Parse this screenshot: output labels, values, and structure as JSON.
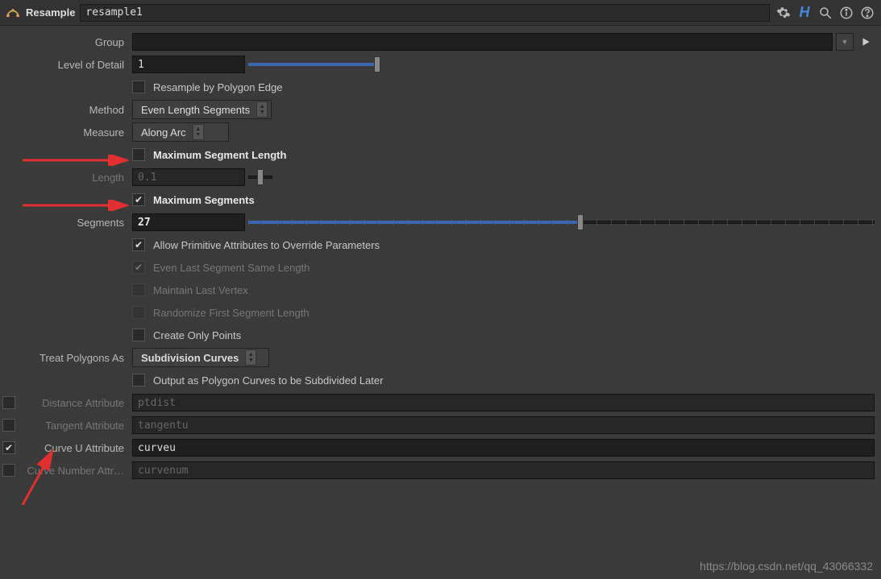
{
  "header": {
    "node_type": "Resample",
    "node_name": "resample1"
  },
  "params": {
    "group": {
      "label": "Group",
      "value": ""
    },
    "lod": {
      "label": "Level of Detail",
      "value": "1",
      "slider_pct": 100
    },
    "resample_by_edge": {
      "label": "Resample by Polygon Edge",
      "checked": false
    },
    "method": {
      "label": "Method",
      "value": "Even Length Segments"
    },
    "measure": {
      "label": "Measure",
      "value": "Along Arc"
    },
    "max_seg_len": {
      "label": "Maximum Segment Length",
      "checked": false
    },
    "length": {
      "label": "Length",
      "value": "0.1"
    },
    "max_segs": {
      "label": "Maximum Segments",
      "checked": true
    },
    "segments": {
      "label": "Segments",
      "value": "27",
      "slider_pct": 53
    },
    "allow_prim_override": {
      "label": "Allow Primitive Attributes to Override Parameters",
      "checked": true
    },
    "even_last": {
      "label": "Even Last Segment Same Length",
      "checked": true,
      "disabled": true
    },
    "maintain_last": {
      "label": "Maintain Last Vertex",
      "checked": false,
      "disabled": true
    },
    "randomize_first": {
      "label": "Randomize First Segment Length",
      "checked": false,
      "disabled": true
    },
    "create_only_points": {
      "label": "Create Only Points",
      "checked": false
    },
    "treat_polys": {
      "label": "Treat Polygons As",
      "value": "Subdivision Curves"
    },
    "output_poly_curves": {
      "label": "Output as Polygon Curves to be Subdivided Later",
      "checked": false
    },
    "dist_attr": {
      "label": "Distance Attribute",
      "value": "ptdist",
      "checked": false
    },
    "tan_attr": {
      "label": "Tangent Attribute",
      "value": "tangentu",
      "checked": false
    },
    "curveu_attr": {
      "label": "Curve U Attribute",
      "value": "curveu",
      "checked": true
    },
    "curvenum_attr": {
      "label": "Curve Number Attr…",
      "value": "curvenum",
      "checked": false
    }
  },
  "watermark": "https://blog.csdn.net/qq_43066332"
}
